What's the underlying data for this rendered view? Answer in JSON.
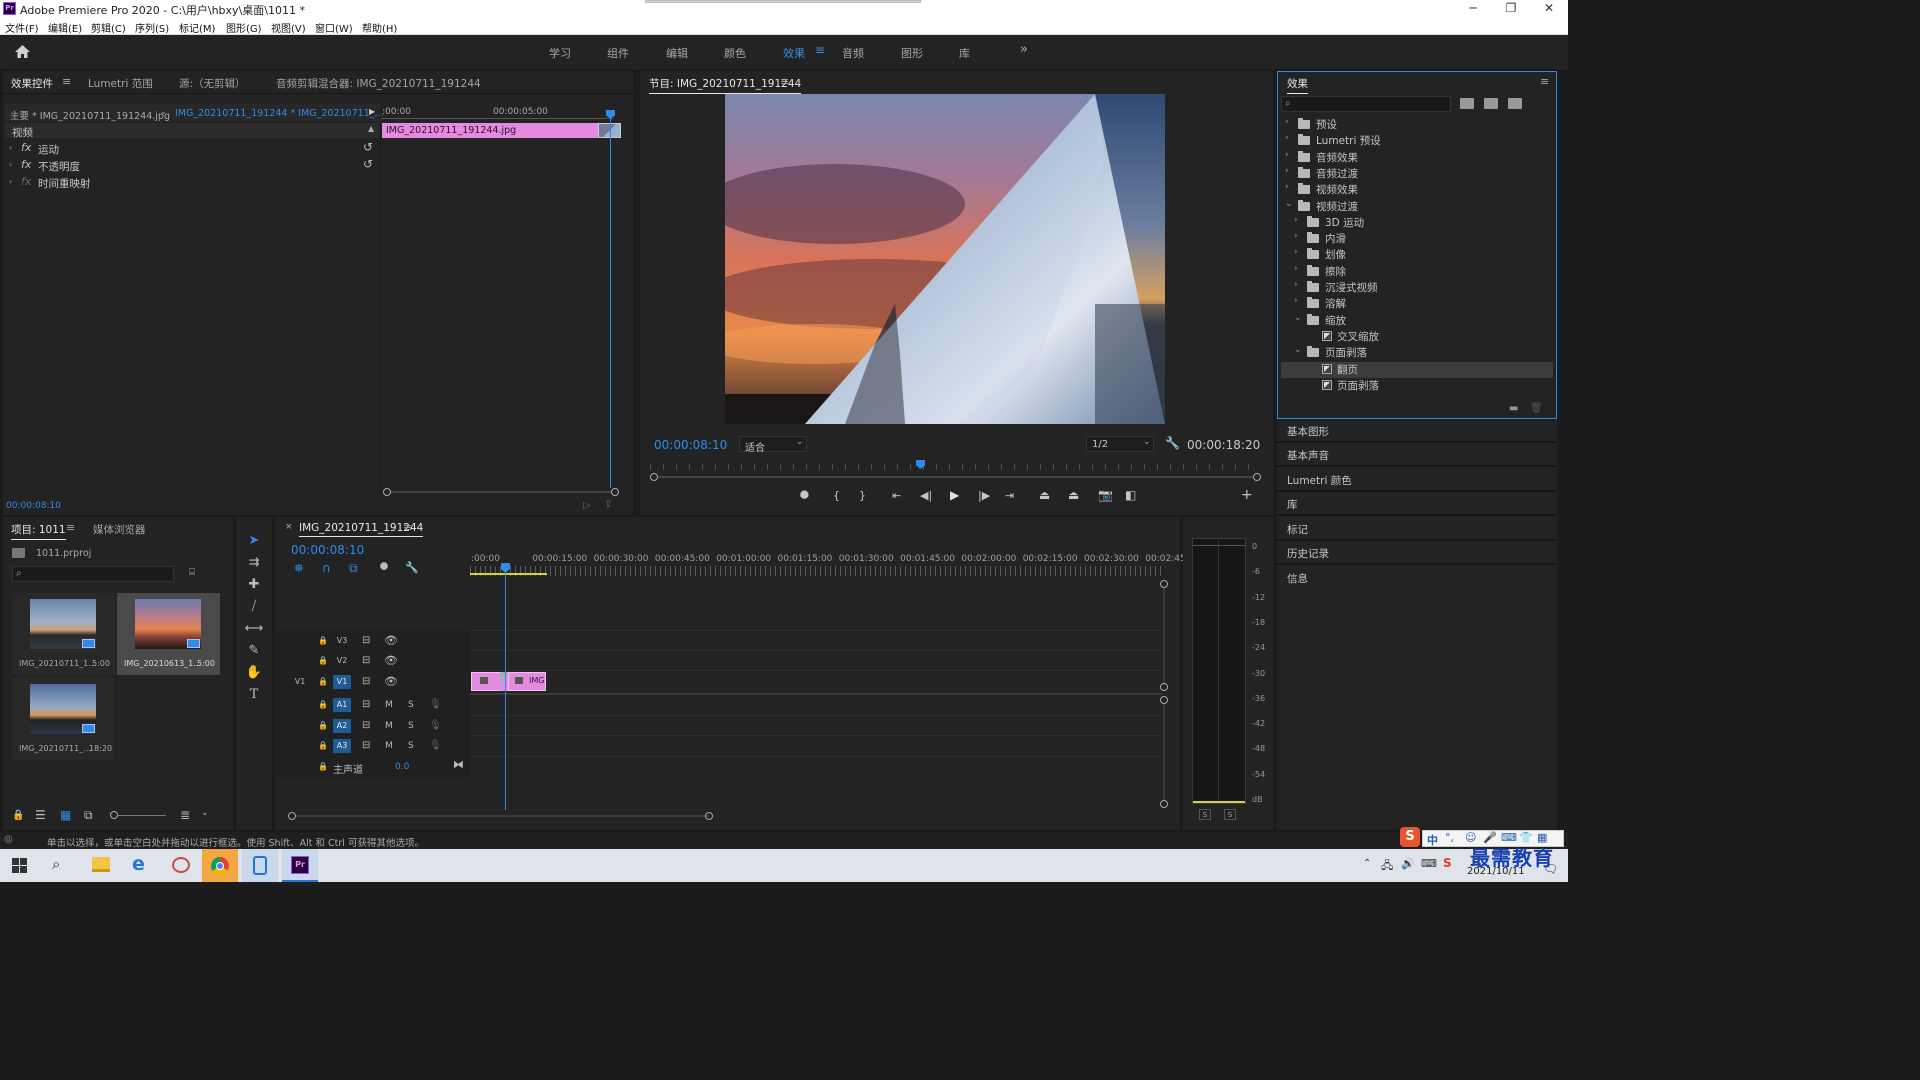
{
  "window": {
    "app_icon": "Pr",
    "title": "Adobe Premiere Pro 2020 - C:\\用户\\hbxy\\桌面\\1011 *",
    "minimize": "─",
    "maximize": "❐",
    "close": "✕"
  },
  "menu": [
    "文件(F)",
    "编辑(E)",
    "剪辑(C)",
    "序列(S)",
    "标记(M)",
    "图形(G)",
    "视图(V)",
    "窗口(W)",
    "帮助(H)"
  ],
  "workspaces": [
    "学习",
    "组件",
    "编辑",
    "颜色",
    "效果",
    "音频",
    "图形",
    "库"
  ],
  "workspace_active": "效果",
  "effect_controls": {
    "tabs": [
      "效果控件",
      "Lumetri 范围",
      "源:（无剪辑）",
      "音频剪辑混合器: IMG_20210711_191244"
    ],
    "source": "主要 * IMG_20210711_191244.jpg",
    "sequence": "IMG_20210711_191244 * IMG_20210711_...",
    "time_start": ":00:00",
    "time_mid": "00:00:05:00",
    "clip_label": "IMG_20210711_191244.jpg",
    "section": "视频",
    "rows": [
      "运动",
      "不透明度",
      "时间重映射"
    ],
    "current_time": "00:00:08:10"
  },
  "program": {
    "title": "节目: IMG_20210711_191244",
    "timecode": "00:00:08:10",
    "fit": "适合",
    "quality": "1/2",
    "duration": "00:00:18:20"
  },
  "effects_panel": {
    "title": "效果",
    "search_placeholder": "",
    "tree": [
      {
        "label": "预设",
        "level": 0,
        "type": "folder",
        "expanded": false
      },
      {
        "label": "Lumetri 预设",
        "level": 0,
        "type": "folder",
        "expanded": false
      },
      {
        "label": "音频效果",
        "level": 0,
        "type": "folder",
        "expanded": false
      },
      {
        "label": "音频过渡",
        "level": 0,
        "type": "folder",
        "expanded": false
      },
      {
        "label": "视频效果",
        "level": 0,
        "type": "folder",
        "expanded": false
      },
      {
        "label": "视频过渡",
        "level": 0,
        "type": "folder",
        "expanded": true
      },
      {
        "label": "3D 运动",
        "level": 1,
        "type": "folder",
        "expanded": false
      },
      {
        "label": "内滑",
        "level": 1,
        "type": "folder",
        "expanded": false
      },
      {
        "label": "划像",
        "level": 1,
        "type": "folder",
        "expanded": false
      },
      {
        "label": "擦除",
        "level": 1,
        "type": "folder",
        "expanded": false
      },
      {
        "label": "沉浸式视频",
        "level": 1,
        "type": "folder",
        "expanded": false
      },
      {
        "label": "溶解",
        "level": 1,
        "type": "folder",
        "expanded": false
      },
      {
        "label": "缩放",
        "level": 1,
        "type": "folder",
        "expanded": true
      },
      {
        "label": "交叉缩放",
        "level": 2,
        "type": "effect"
      },
      {
        "label": "页面剥落",
        "level": 1,
        "type": "folder",
        "expanded": true
      },
      {
        "label": "翻页",
        "level": 2,
        "type": "effect",
        "selected": true
      },
      {
        "label": "页面剥落",
        "level": 2,
        "type": "effect"
      }
    ]
  },
  "side_panels": [
    "基本图形",
    "基本声音",
    "Lumetri 颜色",
    "库",
    "标记",
    "历史记录",
    "信息"
  ],
  "project": {
    "tabs": [
      "项目: 1011",
      "媒体浏览器"
    ],
    "file": "1011.prproj",
    "items": [
      {
        "name": "IMG_20210711_1...",
        "duration": "5:00"
      },
      {
        "name": "IMG_20210613_1...",
        "duration": "5:00"
      },
      {
        "name": "IMG_20210711_...",
        "duration": "18:20"
      }
    ]
  },
  "timeline": {
    "title": "IMG_20210711_191244",
    "timecode": "00:00:08:10",
    "ticks": [
      ":00:00",
      "00:00:15:00",
      "00:00:30:00",
      "00:00:45:00",
      "00:01:00:00",
      "00:01:15:00",
      "00:01:30:00",
      "00:01:45:00",
      "00:02:00:00",
      "00:02:15:00",
      "00:02:30:00",
      "00:02:45:"
    ],
    "tracks": {
      "video": [
        "V3",
        "V2",
        "V1"
      ],
      "audio": [
        "A1",
        "A2",
        "A3"
      ],
      "source_v1": "V1",
      "master": "主声道",
      "master_value": "0.0",
      "m": "M",
      "s": "S"
    },
    "clip_label": "IMG"
  },
  "meter": {
    "labels": [
      "0",
      "-6",
      "-12",
      "-18",
      "-24",
      "-30",
      "-36",
      "-42",
      "-48",
      "-54",
      "dB"
    ],
    "solo": [
      "S",
      "S"
    ]
  },
  "status_bar": "单击以选择，或单击空白处并拖动以进行框选。使用 Shift、Alt 和 Ctrl 可获得其他选项。",
  "taskbar": {
    "date": "2021/10/11",
    "watermark": "最需教育",
    "ime": "中"
  },
  "colors": {
    "accent": "#2d8ceb",
    "clip_pink": "#e48ae0",
    "panel": "#232323",
    "dark": "#1b1b1b"
  }
}
